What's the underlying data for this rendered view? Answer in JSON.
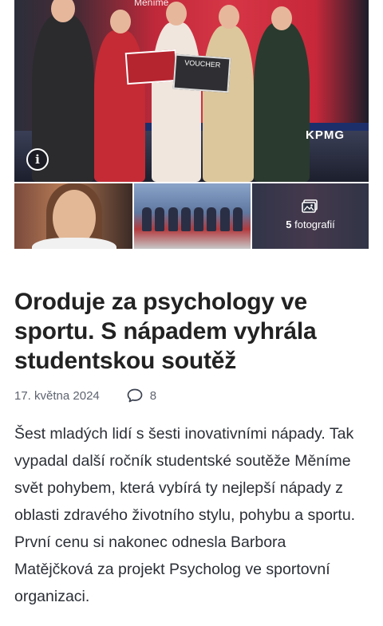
{
  "gallery": {
    "hero_banner_text": "Měníme",
    "hero_logo": "KPMG",
    "voucher_label": "VOUCHER",
    "info_icon": "info-icon",
    "photo_count_number": "5",
    "photo_count_word": "fotografií",
    "photos_icon": "image-gallery-icon"
  },
  "article": {
    "title": "Oroduje za psychology ve sportu. S nápadem vyhrála studentskou soutěž",
    "date": "17. května 2024",
    "comment_count": "8",
    "comment_icon": "comment-bubble-icon",
    "lead": "Šest mladých lidí s šesti inovativními nápady. Tak vypadal další ročník studentské soutěže Měníme svět pohybem, která vybírá ty nejlepší nápady z oblasti zdravého životního stylu, pohybu a sportu. První cenu si nakonec odnesla Barbora Matějčková za projekt Psycholog ve sportovní organizaci."
  }
}
